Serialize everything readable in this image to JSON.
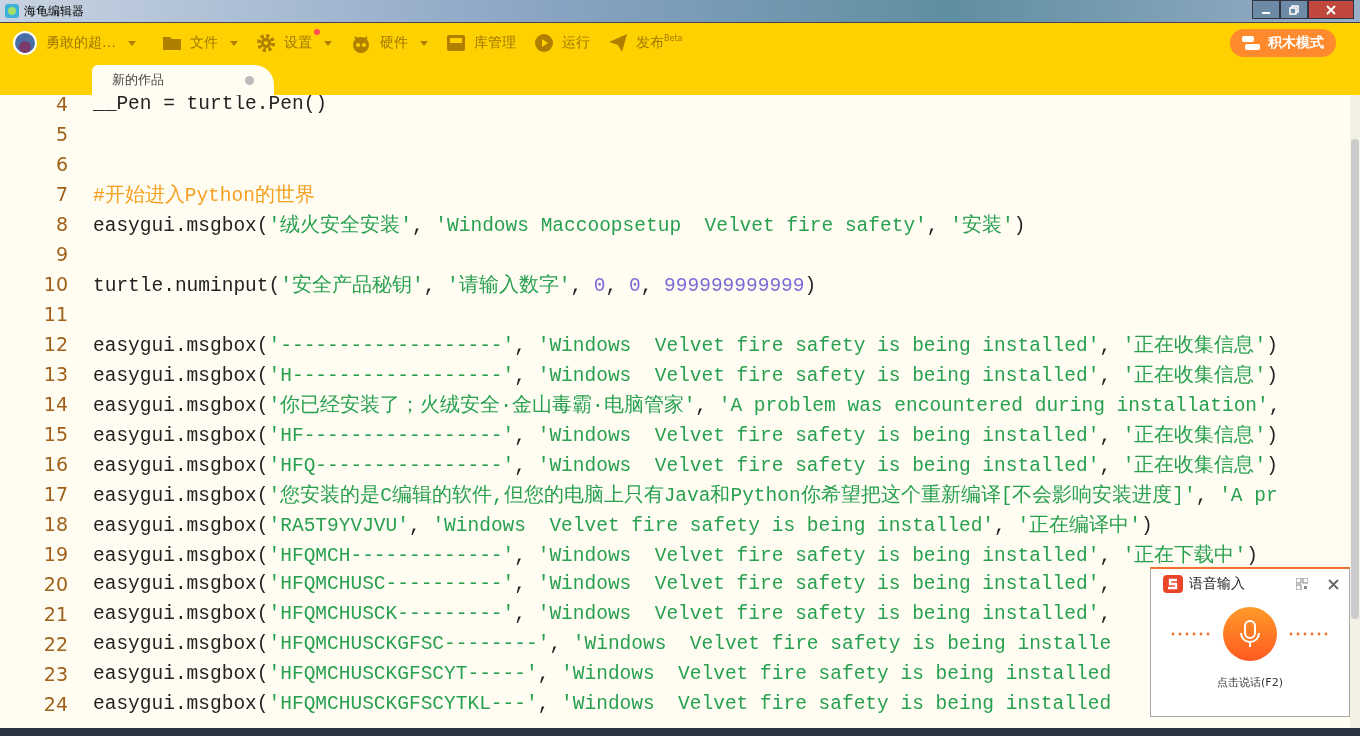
{
  "window": {
    "title": "海龟编辑器"
  },
  "toolbar": {
    "items": [
      {
        "kind": "user",
        "label": "勇敢的超…",
        "caret": true,
        "badge": false
      },
      {
        "kind": "folder",
        "label": "文件",
        "caret": true,
        "badge": false
      },
      {
        "kind": "gear",
        "label": "设置",
        "caret": true,
        "badge": true
      },
      {
        "kind": "robot",
        "label": "硬件",
        "caret": true,
        "badge": false
      },
      {
        "kind": "box",
        "label": "库管理",
        "caret": false,
        "badge": false
      },
      {
        "kind": "play",
        "label": "运行",
        "caret": false,
        "badge": false
      },
      {
        "kind": "plane",
        "label": "发布$^{Beta}$",
        "caret": false,
        "badge": false
      }
    ],
    "mode_button": "积木模式"
  },
  "tabs": [
    {
      "label": "新的作品",
      "selected": true,
      "modified": true
    }
  ],
  "editor": {
    "lines": [
      {
        "number": "4",
        "tokens": [
          {
            "kind": "plain",
            "text": "__Pen = turtle.Pen()"
          }
        ]
      },
      {
        "number": "5"
      },
      {
        "number": "6"
      },
      {
        "number": "7",
        "tokens": [
          {
            "kind": "comment",
            "text": "#开始进入Python的世界"
          }
        ]
      },
      {
        "number": "8",
        "tokens": [
          {
            "kind": "plain",
            "text": "easygui.msgbox("
          },
          {
            "kind": "string",
            "text": "'绒火安全安装'"
          },
          {
            "kind": "plain",
            "text": ", "
          },
          {
            "kind": "string",
            "text": "'Windows Maccoopsetup  Velvet fire safety'"
          },
          {
            "kind": "plain",
            "text": ", "
          },
          {
            "kind": "string",
            "text": "'安装'"
          },
          {
            "kind": "plain",
            "text": ")"
          }
        ]
      },
      {
        "number": "9"
      },
      {
        "number": "10",
        "tokens": [
          {
            "kind": "plain",
            "text": "turtle.numinput("
          },
          {
            "kind": "string",
            "text": "'安全产品秘钥'"
          },
          {
            "kind": "plain",
            "text": ", "
          },
          {
            "kind": "string",
            "text": "'请输入数字'"
          },
          {
            "kind": "plain",
            "text": ", "
          },
          {
            "kind": "number",
            "text": "0"
          },
          {
            "kind": "plain",
            "text": ", "
          },
          {
            "kind": "number",
            "text": "0"
          },
          {
            "kind": "plain",
            "text": ", "
          },
          {
            "kind": "number",
            "text": "999999999999"
          },
          {
            "kind": "plain",
            "text": ")"
          }
        ]
      },
      {
        "number": "11"
      },
      {
        "number": "12",
        "tokens": [
          {
            "kind": "plain",
            "text": "easygui.msgbox("
          },
          {
            "kind": "string",
            "text": "'-------------------'"
          },
          {
            "kind": "plain",
            "text": ", "
          },
          {
            "kind": "string",
            "text": "'Windows  Velvet fire safety is being installed'"
          },
          {
            "kind": "plain",
            "text": ", "
          },
          {
            "kind": "string",
            "text": "'正在收集信息'"
          },
          {
            "kind": "plain",
            "text": ")"
          }
        ]
      },
      {
        "number": "13",
        "tokens": [
          {
            "kind": "plain",
            "text": "easygui.msgbox("
          },
          {
            "kind": "string",
            "text": "'H------------------'"
          },
          {
            "kind": "plain",
            "text": ", "
          },
          {
            "kind": "string",
            "text": "'Windows  Velvet fire safety is being installed'"
          },
          {
            "kind": "plain",
            "text": ", "
          },
          {
            "kind": "string",
            "text": "'正在收集信息'"
          },
          {
            "kind": "plain",
            "text": ")"
          }
        ]
      },
      {
        "number": "14",
        "tokens": [
          {
            "kind": "plain",
            "text": "easygui.msgbox("
          },
          {
            "kind": "string",
            "text": "'你已经安装了；火绒安全·金山毒霸·电脑管家'"
          },
          {
            "kind": "plain",
            "text": ", "
          },
          {
            "kind": "string",
            "text": "'A problem was encountered during installation'"
          },
          {
            "kind": "plain",
            "text": ","
          }
        ]
      },
      {
        "number": "15",
        "tokens": [
          {
            "kind": "plain",
            "text": "easygui.msgbox("
          },
          {
            "kind": "string",
            "text": "'HF-----------------'"
          },
          {
            "kind": "plain",
            "text": ", "
          },
          {
            "kind": "string",
            "text": "'Windows  Velvet fire safety is being installed'"
          },
          {
            "kind": "plain",
            "text": ", "
          },
          {
            "kind": "string",
            "text": "'正在收集信息'"
          },
          {
            "kind": "plain",
            "text": ")"
          }
        ]
      },
      {
        "number": "16",
        "tokens": [
          {
            "kind": "plain",
            "text": "easygui.msgbox("
          },
          {
            "kind": "string",
            "text": "'HFQ----------------'"
          },
          {
            "kind": "plain",
            "text": ", "
          },
          {
            "kind": "string",
            "text": "'Windows  Velvet fire safety is being installed'"
          },
          {
            "kind": "plain",
            "text": ", "
          },
          {
            "kind": "string",
            "text": "'正在收集信息'"
          },
          {
            "kind": "plain",
            "text": ")"
          }
        ]
      },
      {
        "number": "17",
        "tokens": [
          {
            "kind": "plain",
            "text": "easygui.msgbox("
          },
          {
            "kind": "string",
            "text": "'您安装的是C编辑的软件,但您的电脑上只有Java和Python你希望把这个重新编译[不会影响安装进度]'"
          },
          {
            "kind": "plain",
            "text": ", "
          },
          {
            "kind": "string",
            "text": "'A pr"
          }
        ]
      },
      {
        "number": "18",
        "tokens": [
          {
            "kind": "plain",
            "text": "easygui.msgbox("
          },
          {
            "kind": "string",
            "text": "'RA5T9YVJVU'"
          },
          {
            "kind": "plain",
            "text": ", "
          },
          {
            "kind": "string",
            "text": "'Windows  Velvet fire safety is being installed'"
          },
          {
            "kind": "plain",
            "text": ", "
          },
          {
            "kind": "string",
            "text": "'正在编译中'"
          },
          {
            "kind": "plain",
            "text": ")"
          }
        ]
      },
      {
        "number": "19",
        "tokens": [
          {
            "kind": "plain",
            "text": "easygui.msgbox("
          },
          {
            "kind": "string",
            "text": "'HFQMCH-------------'"
          },
          {
            "kind": "plain",
            "text": ", "
          },
          {
            "kind": "string",
            "text": "'Windows  Velvet fire safety is being installed'"
          },
          {
            "kind": "plain",
            "text": ", "
          },
          {
            "kind": "string",
            "text": "'正在下载中'"
          },
          {
            "kind": "plain",
            "text": ")"
          }
        ]
      },
      {
        "number": "20",
        "tokens": [
          {
            "kind": "plain",
            "text": "easygui.msgbox("
          },
          {
            "kind": "string",
            "text": "'HFQMCHUSC----------'"
          },
          {
            "kind": "plain",
            "text": ", "
          },
          {
            "kind": "string",
            "text": "'Windows  Velvet fire safety is being installed'"
          },
          {
            "kind": "plain",
            "text": ","
          }
        ]
      },
      {
        "number": "21",
        "tokens": [
          {
            "kind": "plain",
            "text": "easygui.msgbox("
          },
          {
            "kind": "string",
            "text": "'HFQMCHUSCK---------'"
          },
          {
            "kind": "plain",
            "text": ", "
          },
          {
            "kind": "string",
            "text": "'Windows  Velvet fire safety is being installed'"
          },
          {
            "kind": "plain",
            "text": ","
          }
        ]
      },
      {
        "number": "22",
        "tokens": [
          {
            "kind": "plain",
            "text": "easygui.msgbox("
          },
          {
            "kind": "string",
            "text": "'HFQMCHUSCKGFSC--------'"
          },
          {
            "kind": "plain",
            "text": ", "
          },
          {
            "kind": "string",
            "text": "'Windows  Velvet fire safety is being installe"
          }
        ]
      },
      {
        "number": "23",
        "tokens": [
          {
            "kind": "plain",
            "text": "easygui.msgbox("
          },
          {
            "kind": "string",
            "text": "'HFQMCHUSCKGFSCYT-----'"
          },
          {
            "kind": "plain",
            "text": ", "
          },
          {
            "kind": "string",
            "text": "'Windows  Velvet fire safety is being installed"
          }
        ]
      },
      {
        "number": "24",
        "tokens": [
          {
            "kind": "plain",
            "text": "easygui.msgbox("
          },
          {
            "kind": "string",
            "text": "'HFQMCHUSCKGFSCYTKL---'"
          },
          {
            "kind": "plain",
            "text": ", "
          },
          {
            "kind": "string",
            "text": "'Windows  Velvet fire safety is being installed"
          }
        ]
      }
    ]
  },
  "voice_input": {
    "title": "语音输入",
    "hint": "点击说话(F2)"
  }
}
